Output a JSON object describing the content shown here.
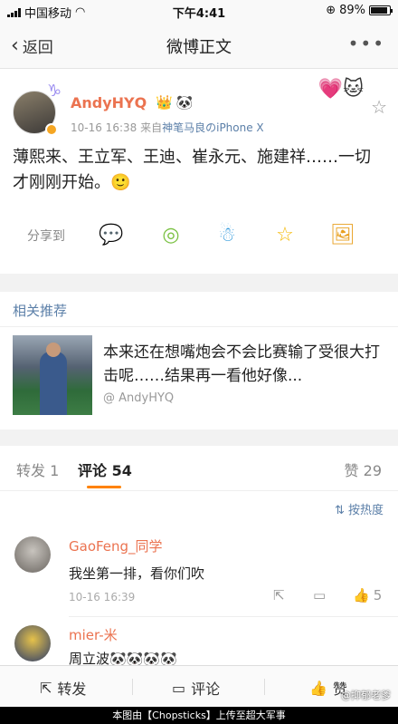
{
  "status": {
    "carrier": "中国移动",
    "time": "下午4:41",
    "battery": "89%"
  },
  "nav": {
    "back": "返回",
    "title": "微博正文",
    "more": "•••"
  },
  "post": {
    "username": "AndyHYQ",
    "time": "10-16 16:38",
    "source_prefix": "来自",
    "source": "神笔马良のiPhone X",
    "text": "薄熙来、王立军、王迪、崔永元、施建祥……一切才刚刚开始。🙂",
    "share_label": "分享到"
  },
  "related": {
    "title": "相关推荐",
    "text": "本来还在想嘴炮会不会比赛输了受很大打击呢……结果再一看他好像...",
    "author": "@ AndyHYQ"
  },
  "tabs": {
    "repost": "转发 1",
    "comment": "评论 54",
    "like": "赞 29"
  },
  "sort_label": "⇅ 按热度",
  "comments": [
    {
      "name": "GaoFeng_同学",
      "text": "我坐第一排，看你们吹",
      "time": "10-16 16:39",
      "likes": "5"
    },
    {
      "name": "mier-米",
      "text": "周立波🐼🐼🐼🐼"
    }
  ],
  "bottom": {
    "repost": "转发",
    "comment": "评论",
    "like": "赞"
  },
  "footer": {
    "text": "本图由【Chopsticks】上传至超大军事",
    "watermark": "@抑郁老爹"
  },
  "colors": {
    "accent": "#ff8200",
    "name": "#eb7350",
    "link": "#5b7fa8"
  }
}
